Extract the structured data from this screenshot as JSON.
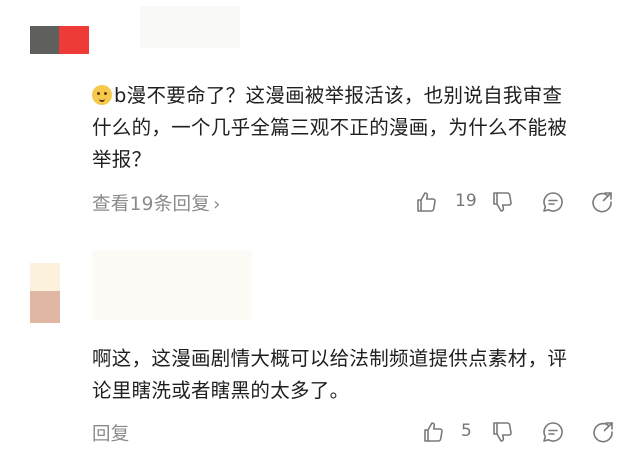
{
  "comments": [
    {
      "text_line1": "b漫不要命了？这漫画被举报活该，也别说自我审查",
      "text_line2": "什么的，一个几乎全篇三观不正的漫画，为什么不能被",
      "text_line3": "举报？",
      "reply_label": "查看19条回复",
      "likes": "19",
      "emoji": "thinking-face-icon"
    },
    {
      "text_line1": "啊这，这漫画剧情大概可以给法制频道提供点素材，评",
      "text_line2": "论里瞎洗或者瞎黑的太多了。",
      "reply_label": "回复",
      "likes": "5"
    }
  ],
  "colors": {
    "text": "#1f1f1f",
    "meta": "#8a8a8a",
    "avatar1_left": "#5f5f5b",
    "avatar1_right": "#ee3b37",
    "avatar2_top": "#fbf1dc",
    "avatar2_bottom": "#dfb7a3"
  }
}
